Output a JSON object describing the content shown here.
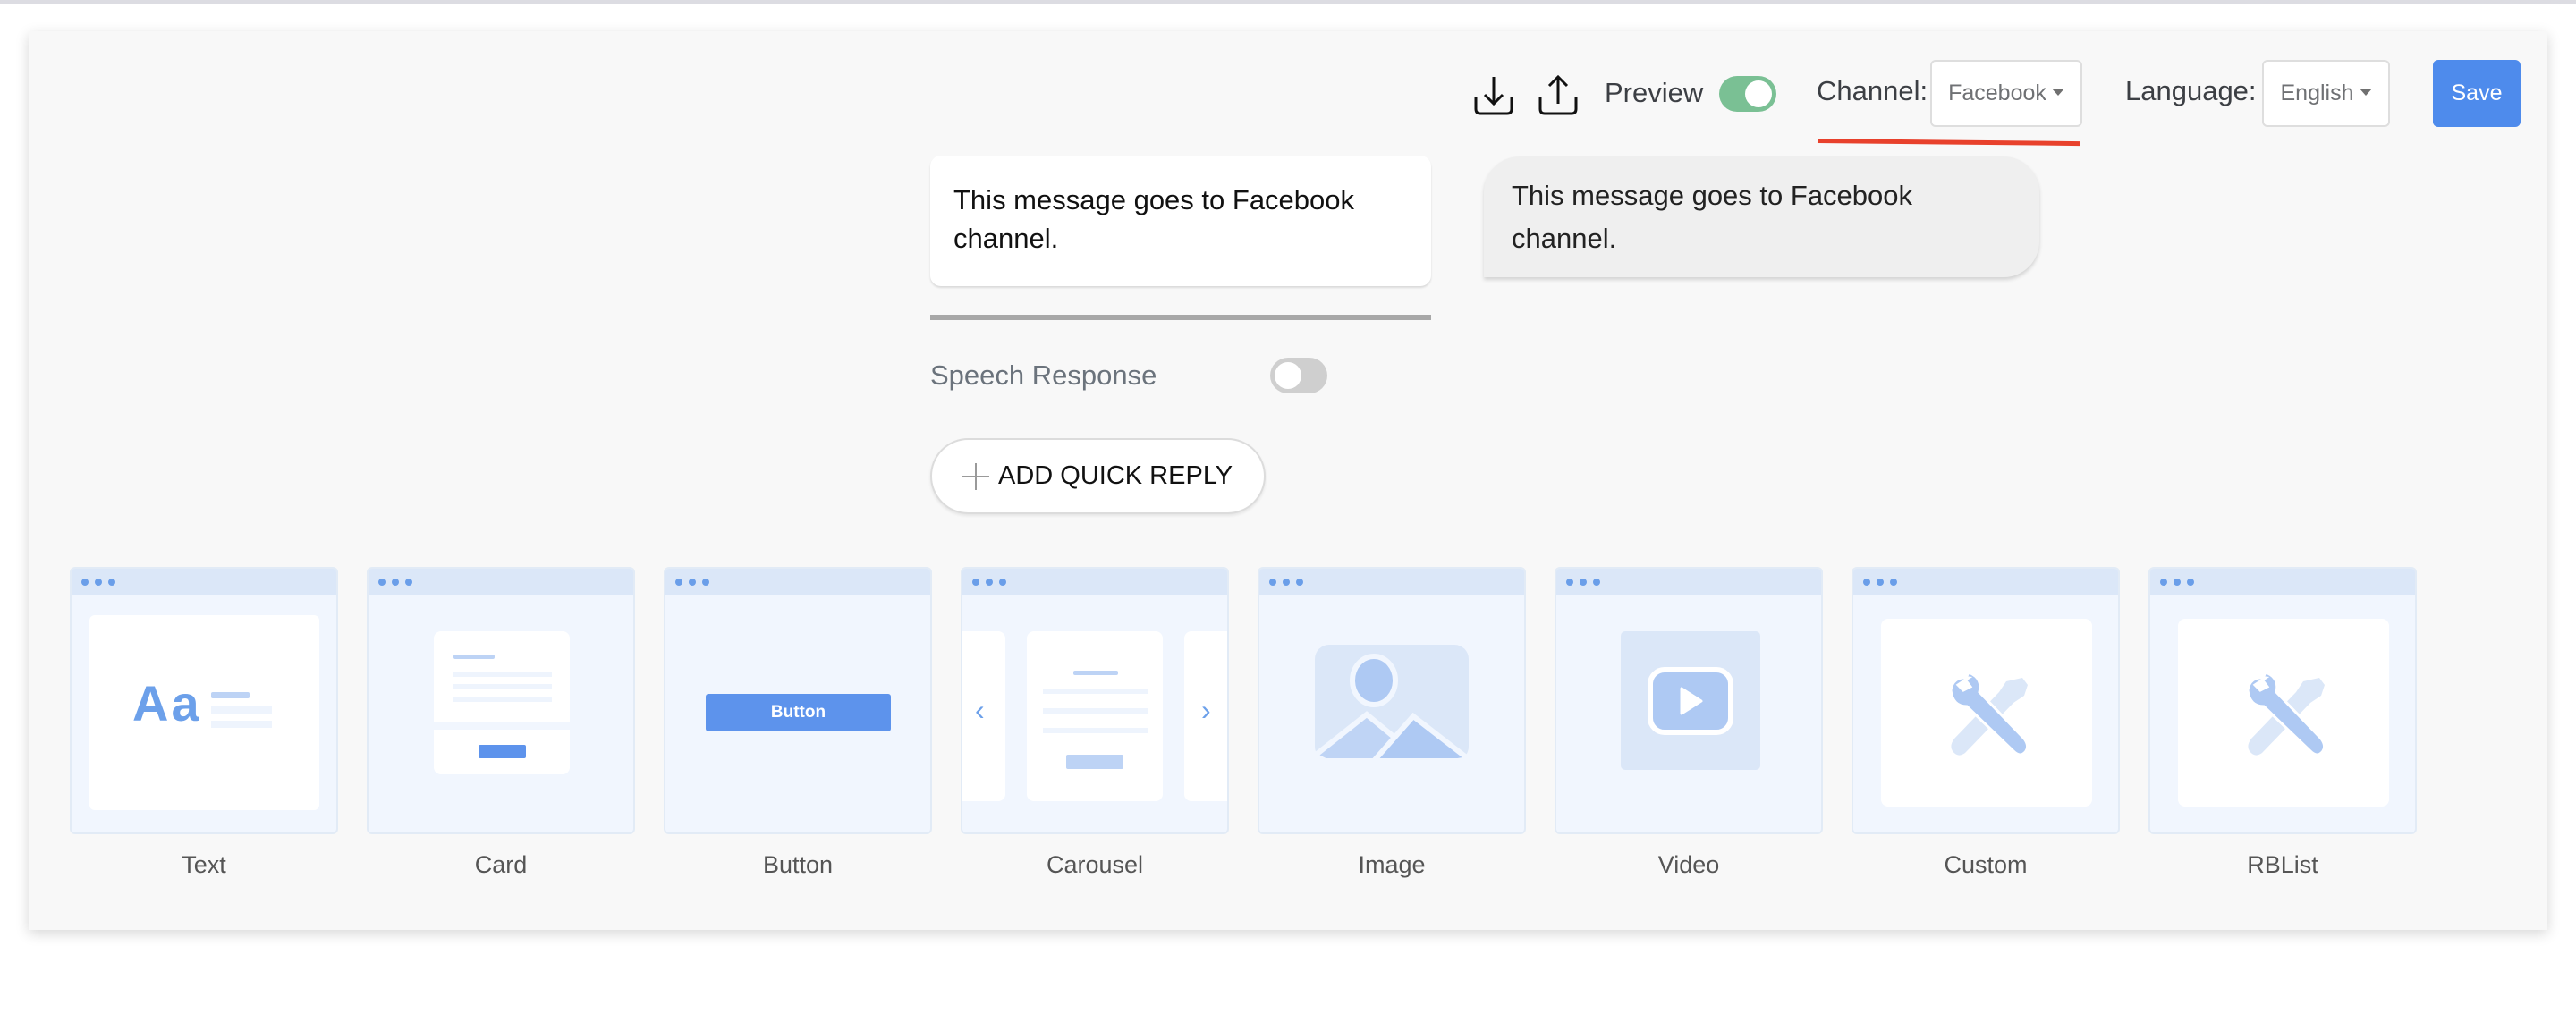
{
  "toolbar": {
    "download_icon": "download-icon",
    "upload_icon": "upload-icon",
    "preview_label": "Preview",
    "preview_enabled": true,
    "channel_label": "Channel:",
    "channel_value": "Facebook",
    "language_label": "Language:",
    "language_value": "English",
    "save_label": "Save",
    "accent_color": "#4e8bec",
    "toggle_on_color": "#7ac094",
    "annotation_color": "#e8412c"
  },
  "editor": {
    "message_text": "This message goes to Facebook channel.",
    "preview_bubble_text": "This message goes to Facebook channel.",
    "speech_response_label": "Speech Response",
    "speech_response_enabled": false,
    "add_quick_reply_label": "ADD QUICK REPLY"
  },
  "templates": [
    {
      "label": "Text",
      "icon": "text-template-icon",
      "sample": "Aa"
    },
    {
      "label": "Card",
      "icon": "card-template-icon"
    },
    {
      "label": "Button",
      "icon": "button-template-icon",
      "sample": "Button"
    },
    {
      "label": "Carousel",
      "icon": "carousel-template-icon"
    },
    {
      "label": "Image",
      "icon": "image-template-icon"
    },
    {
      "label": "Video",
      "icon": "video-template-icon"
    },
    {
      "label": "Custom",
      "icon": "custom-template-icon"
    },
    {
      "label": "RBList",
      "icon": "rblist-template-icon"
    }
  ]
}
